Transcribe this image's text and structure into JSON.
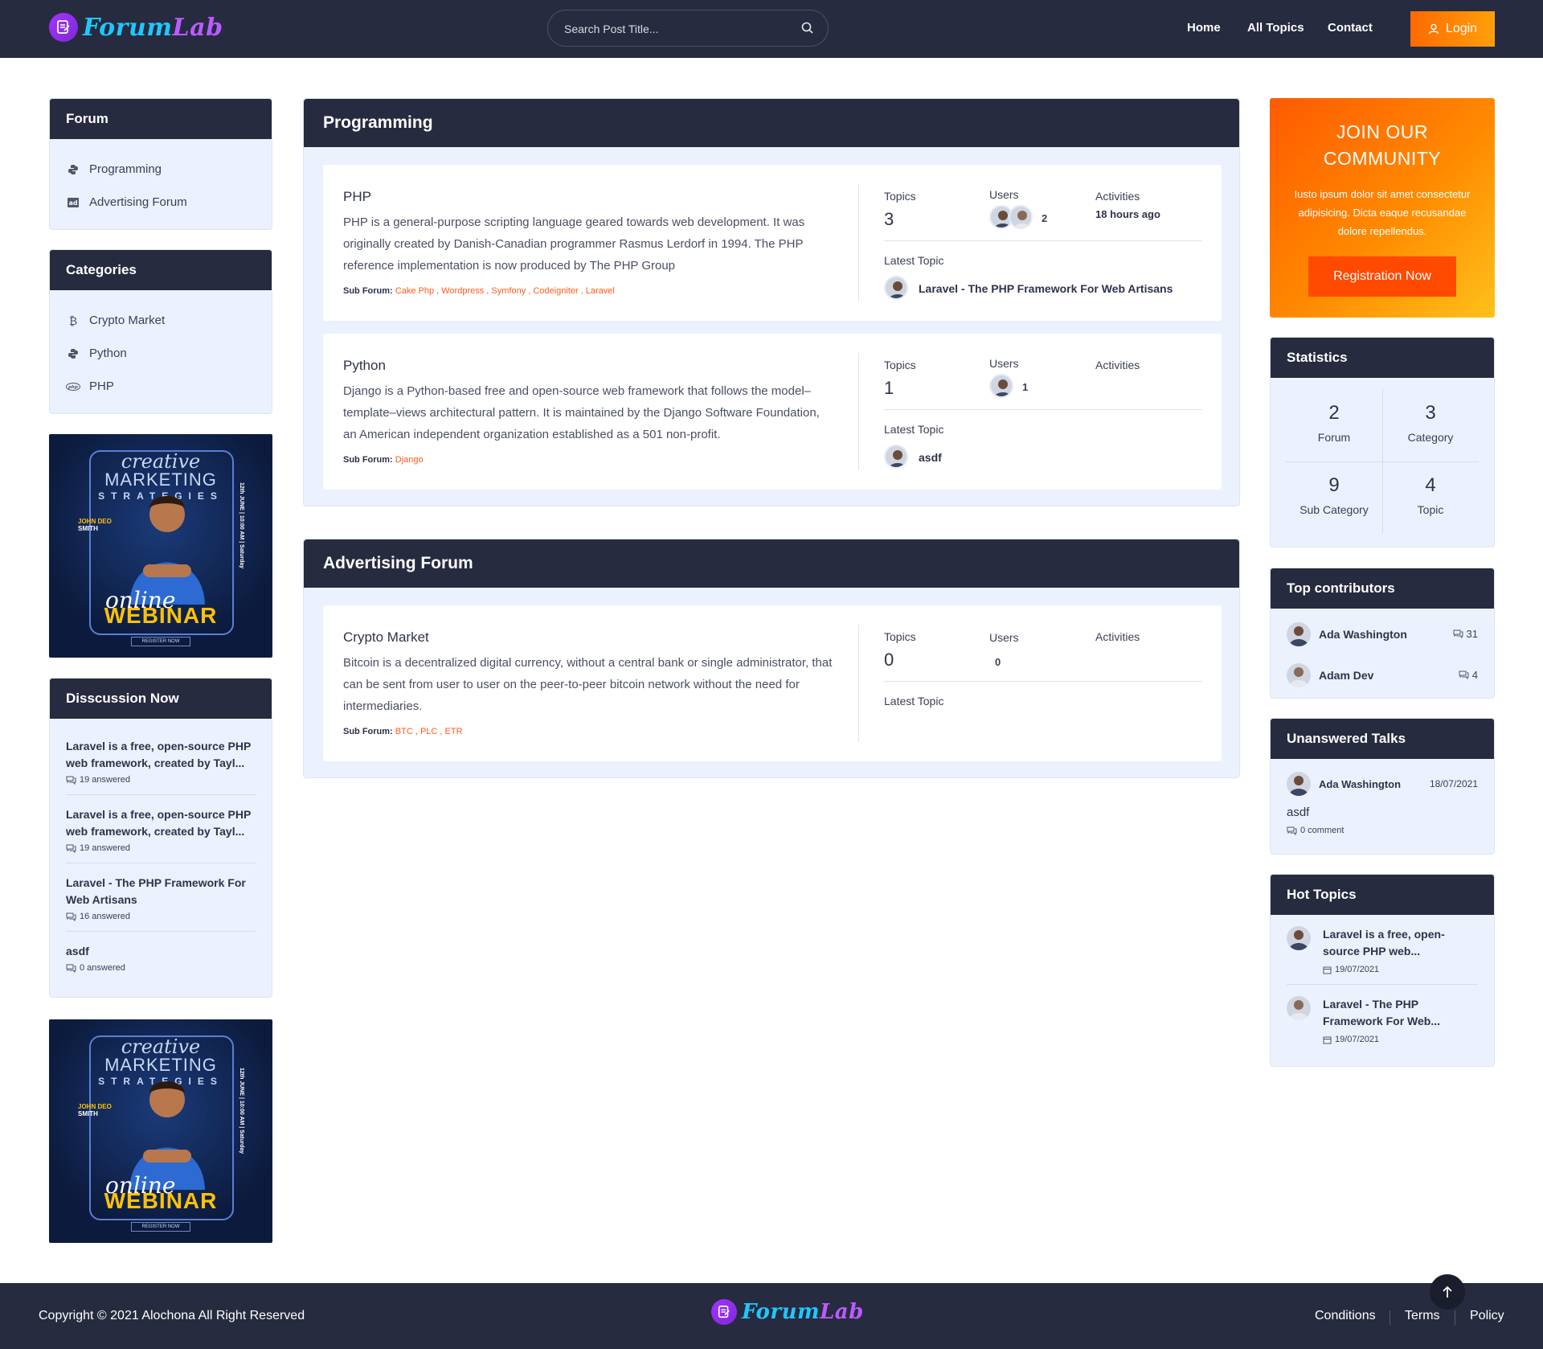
{
  "header": {
    "logo_part1": "Forum",
    "logo_part2": "Lab",
    "search_placeholder": "Search Post Title...",
    "nav": [
      "Home",
      "All Topics",
      "Contact"
    ],
    "login_label": "Login"
  },
  "sidebar": {
    "forum_title": "Forum",
    "forum_items": [
      "Programming",
      "Advertising Forum"
    ],
    "categories_title": "Categories",
    "category_items": [
      "Crypto Market",
      "Python",
      "PHP"
    ],
    "ad": {
      "line1": "creative",
      "line2": "MARKETING",
      "line3": "STRATEGIES",
      "name1": "JOHN DEO",
      "name2": "SMITH",
      "side": "12th JUNE  |  10:00 AM  |  Saturday",
      "online": "online",
      "webinar": "WEBINAR",
      "register": "REGISTER NOW"
    },
    "discussion_title": "Disscussion Now",
    "discussions": [
      {
        "title": "Laravel is a free, open-source PHP web framework, created by Tayl...",
        "meta": "19 answered"
      },
      {
        "title": "Laravel is a free, open-source PHP web framework, created by Tayl...",
        "meta": "19 answered"
      },
      {
        "title": "Laravel - The PHP Framework For Web Artisans",
        "meta": "16 answered"
      },
      {
        "title": "asdf",
        "meta": "0 answered"
      }
    ]
  },
  "main": {
    "labels": {
      "topics": "Topics",
      "users": "Users",
      "activities": "Activities",
      "latest": "Latest Topic",
      "sub_forum": "Sub Forum:"
    },
    "programming": {
      "title": "Programming",
      "php": {
        "title": "PHP",
        "desc": "PHP is a general-purpose scripting language geared towards web development. It was originally created by Danish-Canadian programmer Rasmus Lerdorf in 1994. The PHP reference implementation is now produced by The PHP Group",
        "sub_forums": "Cake Php , Wordpress , Symfony , Codeigniter , Laravel",
        "topics": "3",
        "users": "2",
        "activities": "18 hours ago",
        "latest": "Laravel - The PHP Framework For Web Artisans"
      },
      "python": {
        "title": "Python",
        "desc": "Django is a Python-based free and open-source web framework that follows the model–template–views architectural pattern. It is maintained by the Django Software Foundation, an American independent organization established as a 501 non-profit.",
        "sub_forums": "Django",
        "topics": "1",
        "users": "1",
        "latest": "asdf"
      }
    },
    "advertising": {
      "title": "Advertising Forum",
      "crypto": {
        "title": "Crypto Market",
        "desc": "Bitcoin is a decentralized digital currency, without a central bank or single administrator, that can be sent from user to user on the peer-to-peer bitcoin network without the need for intermediaries.",
        "sub_forums": "BTC , PLC , ETR",
        "topics": "0",
        "users": "0"
      }
    }
  },
  "right": {
    "join": {
      "title1": "JOIN OUR",
      "title2": "COMMUNITY",
      "desc": "Iusto ipsum dolor sit amet consectetur adipisicing. Dicta eaque recusandae dolore repellendus.",
      "button": "Registration Now"
    },
    "statistics_title": "Statistics",
    "stats": [
      {
        "num": "2",
        "label": "Forum"
      },
      {
        "num": "3",
        "label": "Category"
      },
      {
        "num": "9",
        "label": "Sub Category"
      },
      {
        "num": "4",
        "label": "Topic"
      }
    ],
    "contributors_title": "Top contributors",
    "contributors": [
      {
        "name": "Ada Washington",
        "count": "31"
      },
      {
        "name": "Adam Dev",
        "count": "4"
      }
    ],
    "unanswered_title": "Unanswered Talks",
    "unanswered": {
      "name": "Ada Washington",
      "date": "18/07/2021",
      "title": "asdf",
      "meta": "0 comment"
    },
    "hot_title": "Hot Topics",
    "hot": [
      {
        "title": "Laravel is a free, open-source PHP web...",
        "date": "19/07/2021"
      },
      {
        "title": "Laravel - The PHP Framework For Web...",
        "date": "19/07/2021"
      }
    ]
  },
  "footer": {
    "copyright": "Copyright © 2021 Alochona All Right Reserved",
    "links": [
      "Conditions",
      "Terms",
      "Policy"
    ]
  }
}
